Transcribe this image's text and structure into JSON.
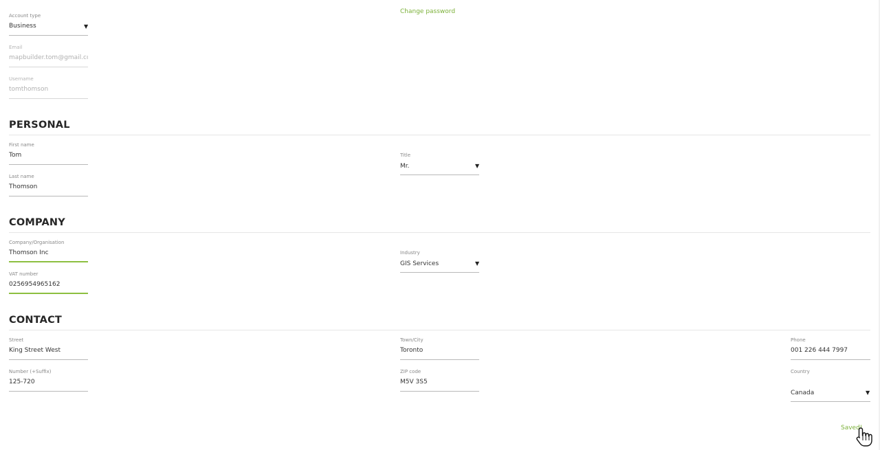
{
  "account": {
    "account_type": {
      "label": "Account type",
      "value": "Business"
    },
    "email": {
      "label": "Email",
      "value": "mapbuilder.tom@gmail.com"
    },
    "username": {
      "label": "Username",
      "value": "tomthomson"
    },
    "change_password": "Change password"
  },
  "personal": {
    "title": "PERSONAL",
    "first_name": {
      "label": "First name",
      "value": "Tom"
    },
    "last_name": {
      "label": "Last name",
      "value": "Thomson"
    },
    "salutation": {
      "label": "Title",
      "value": "Mr."
    }
  },
  "company": {
    "title": "COMPANY",
    "organisation": {
      "label": "Company/Organisation",
      "value": "Thomson Inc"
    },
    "vat": {
      "label": "VAT number",
      "value": "0256954965162"
    },
    "industry": {
      "label": "Industry",
      "value": "GIS Services"
    }
  },
  "contact": {
    "title": "CONTACT",
    "street": {
      "label": "Street",
      "value": "King Street West"
    },
    "number": {
      "label": "Number (+Suffix)",
      "value": "125-720"
    },
    "town": {
      "label": "Town/City",
      "value": "Toronto"
    },
    "zip": {
      "label": "ZIP code",
      "value": "M5V 3S5"
    },
    "phone": {
      "label": "Phone",
      "value": "001 226 444 7997"
    },
    "country": {
      "label": "Country",
      "value": "Canada"
    }
  },
  "status": {
    "saved": "Saved!"
  },
  "icons": {
    "dropdown": "caret-down-icon",
    "cursor": "hand-pointer-icon"
  },
  "colors": {
    "accent": "#7cb13a",
    "text": "#333333",
    "muted": "#888888"
  }
}
